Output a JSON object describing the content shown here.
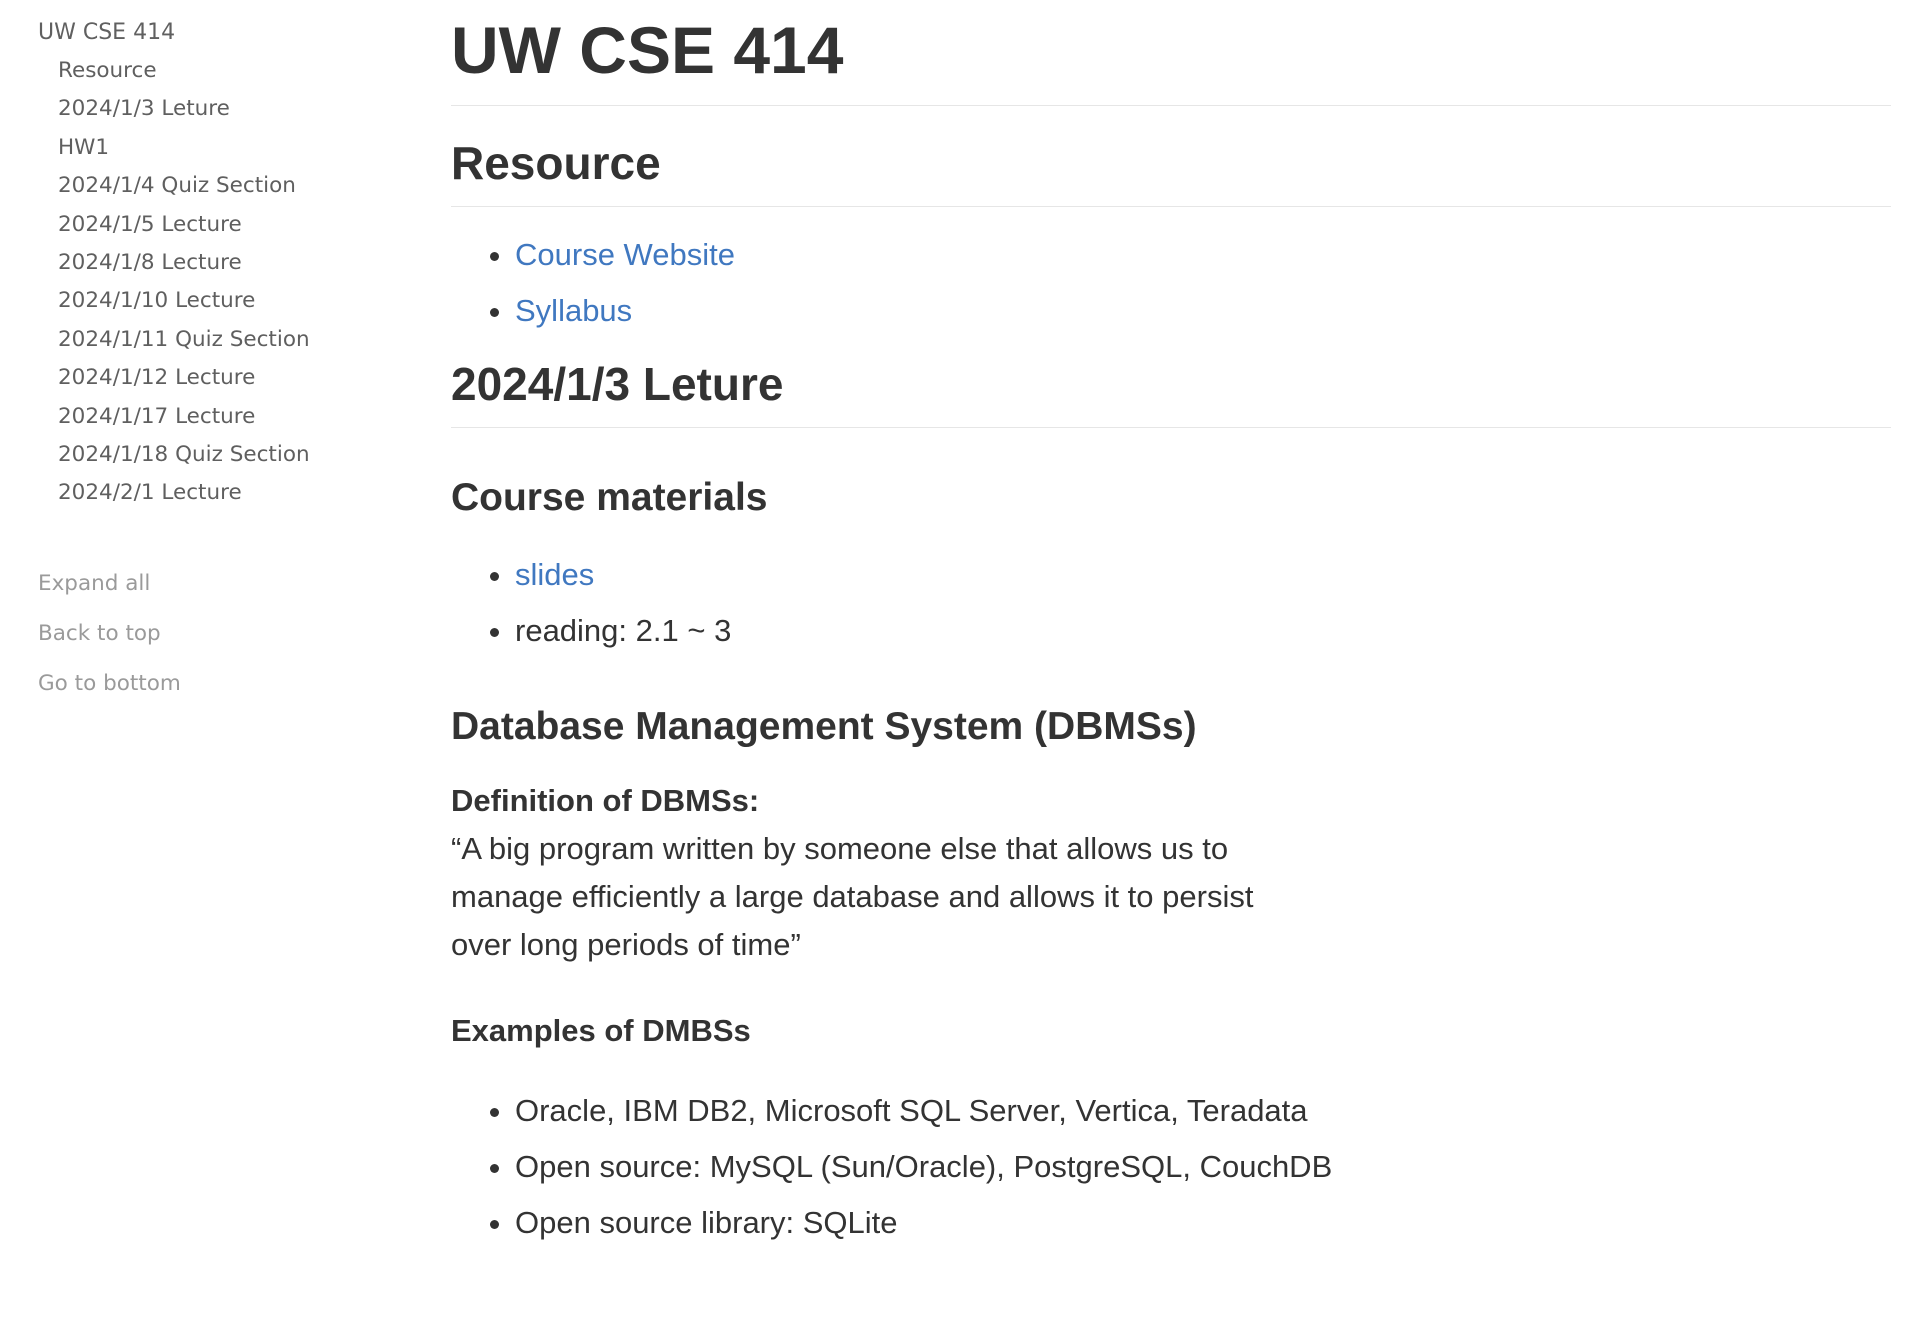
{
  "toc": {
    "root": "UW CSE 414",
    "items": [
      {
        "label": "Resource"
      },
      {
        "label": "2024/1/3 Leture"
      },
      {
        "label": "HW1"
      },
      {
        "label": "2024/1/4 Quiz Section"
      },
      {
        "label": "2024/1/5 Lecture"
      },
      {
        "label": "2024/1/8 Lecture"
      },
      {
        "label": "2024/1/10 Lecture"
      },
      {
        "label": "2024/1/11 Quiz Section"
      },
      {
        "label": "2024/1/12 Lecture"
      },
      {
        "label": "2024/1/17 Lecture"
      },
      {
        "label": "2024/1/18 Quiz Section"
      },
      {
        "label": "2024/2/1 Lecture"
      }
    ],
    "actions": {
      "expand_all": "Expand all",
      "back_to_top": "Back to top",
      "go_to_bottom": "Go to bottom"
    }
  },
  "main": {
    "title": "UW CSE 414",
    "resource": {
      "heading": "Resource",
      "links": [
        {
          "label": "Course Website"
        },
        {
          "label": "Syllabus"
        }
      ]
    },
    "lecture": {
      "heading": "2024/1/3 Leture",
      "materials": {
        "heading": "Course materials",
        "slides_link": "slides",
        "reading": "reading: 2.1 ~ 3"
      },
      "dbms": {
        "heading": "Database Management System (DBMSs)",
        "definition_label": "Definition of DBMSs:",
        "definition_text": "“A big program written by someone else that allows us to manage efficiently a large database and allows it to persist over long periods of time”",
        "examples_label": "Examples of DMBSs",
        "examples": [
          "Oracle, IBM DB2, Microsoft SQL Server, Vertica, Teradata",
          "Open source: MySQL (Sun/Oracle), PostgreSQL, CouchDB",
          "Open source library: SQLite"
        ]
      }
    }
  },
  "colors": {
    "text": "#333333",
    "link": "#4078c0",
    "toc_text": "#5f5f5f",
    "toc_action": "#9a9a9a",
    "divider": "#e6e6e6"
  }
}
